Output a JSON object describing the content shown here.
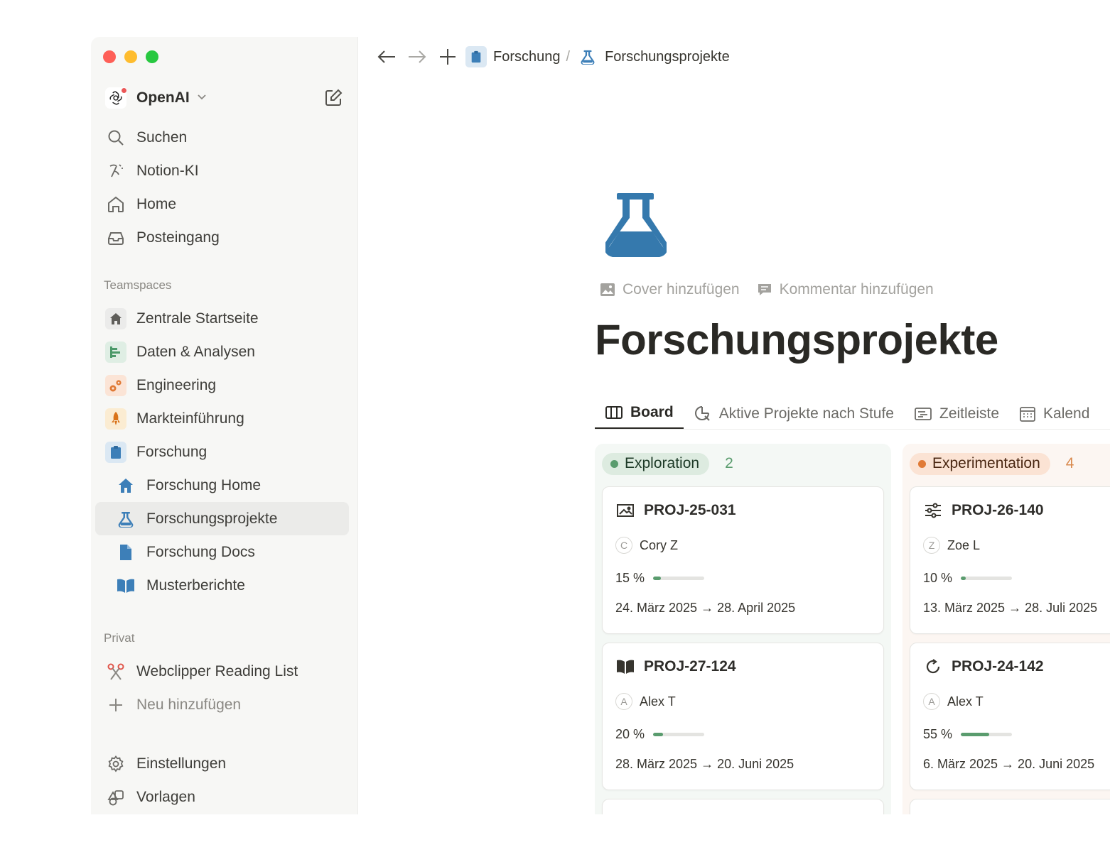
{
  "window_controls": [
    "close",
    "minimize",
    "zoom"
  ],
  "workspace": {
    "name": "OpenAI",
    "logo_icon": "openai-logo",
    "new_page_icon": "compose-icon"
  },
  "sidebar": {
    "nav": [
      {
        "label": "Suchen",
        "icon": "search-icon"
      },
      {
        "label": "Notion-KI",
        "icon": "ai-icon"
      },
      {
        "label": "Home",
        "icon": "home-icon"
      },
      {
        "label": "Posteingang",
        "icon": "inbox-icon"
      }
    ],
    "teamspaces_label": "Teamspaces",
    "teamspaces": [
      {
        "label": "Zentrale Startseite",
        "icon": "house-icon",
        "color": "#787774",
        "bg": "#ebebea"
      },
      {
        "label": "Daten & Analysen",
        "icon": "chart-icon",
        "color": "#4c9a6a",
        "bg": "#dfeee4"
      },
      {
        "label": "Engineering",
        "icon": "gears-icon",
        "color": "#e07a36",
        "bg": "#fbe4d6"
      },
      {
        "label": "Markteinführung",
        "icon": "rocket-icon",
        "color": "#d9731a",
        "bg": "#fbecd2"
      },
      {
        "label": "Forschung",
        "icon": "clipboard-icon",
        "color": "#3d7fb8",
        "bg": "#dbe8f3"
      }
    ],
    "forschung_children": [
      {
        "label": "Forschung Home",
        "icon": "house-icon"
      },
      {
        "label": "Forschungsprojekte",
        "icon": "flask-icon",
        "active": true
      },
      {
        "label": "Forschung Docs",
        "icon": "document-icon"
      },
      {
        "label": "Musterberichte",
        "icon": "book-icon"
      }
    ],
    "private_label": "Privat",
    "private": [
      {
        "label": "Webclipper Reading List",
        "icon": "scissors-icon"
      },
      {
        "label": "Neu hinzufügen",
        "icon": "plus-icon"
      }
    ],
    "footer": [
      {
        "label": "Einstellungen",
        "icon": "gear-icon"
      },
      {
        "label": "Vorlagen",
        "icon": "templates-icon"
      }
    ]
  },
  "topbar": {
    "breadcrumb": [
      {
        "label": "Forschung",
        "icon": "clipboard-icon"
      },
      {
        "label": "Forschungsprojekte",
        "icon": "flask-icon"
      }
    ],
    "separator": "/"
  },
  "page": {
    "icon": "flask-icon",
    "add_cover": "Cover hinzufügen",
    "add_comment": "Kommentar hinzufügen",
    "title": "Forschungsprojekte",
    "tabs": [
      {
        "label": "Board",
        "icon": "board-icon",
        "active": true
      },
      {
        "label": "Aktive Projekte nach Stufe",
        "icon": "chart-search-icon"
      },
      {
        "label": "Zeitleiste",
        "icon": "timeline-icon"
      },
      {
        "label": "Kalend",
        "icon": "calendar-icon"
      }
    ]
  },
  "board": {
    "columns": [
      {
        "name": "Exploration",
        "count": "2",
        "color": "green",
        "cards": [
          {
            "id": "PROJ-25-031",
            "icon": "image-icon",
            "person_initial": "C",
            "person": "Cory Z",
            "progress_label": "15 %",
            "progress": 0.15,
            "dates": "24. März 2025 → 28. April 2025"
          },
          {
            "id": "PROJ-27-124",
            "icon": "book-icon",
            "person_initial": "A",
            "person": "Alex T",
            "progress_label": "20 %",
            "progress": 0.2,
            "dates": "28. März 2025 → 20. Juni 2025"
          }
        ]
      },
      {
        "name": "Experimentation",
        "count": "4",
        "color": "orange",
        "cards": [
          {
            "id": "PROJ-26-140",
            "icon": "sliders-icon",
            "person_initial": "Z",
            "person": "Zoe L",
            "progress_label": "10 %",
            "progress": 0.1,
            "dates": "13. März 2025 → 28. Juli 2025"
          },
          {
            "id": "PROJ-24-142",
            "icon": "refresh-icon",
            "person_initial": "A",
            "person": "Alex T",
            "progress_label": "55 %",
            "progress": 0.55,
            "dates": "6. März 2025 → 20. Juni 2025"
          }
        ]
      }
    ]
  }
}
